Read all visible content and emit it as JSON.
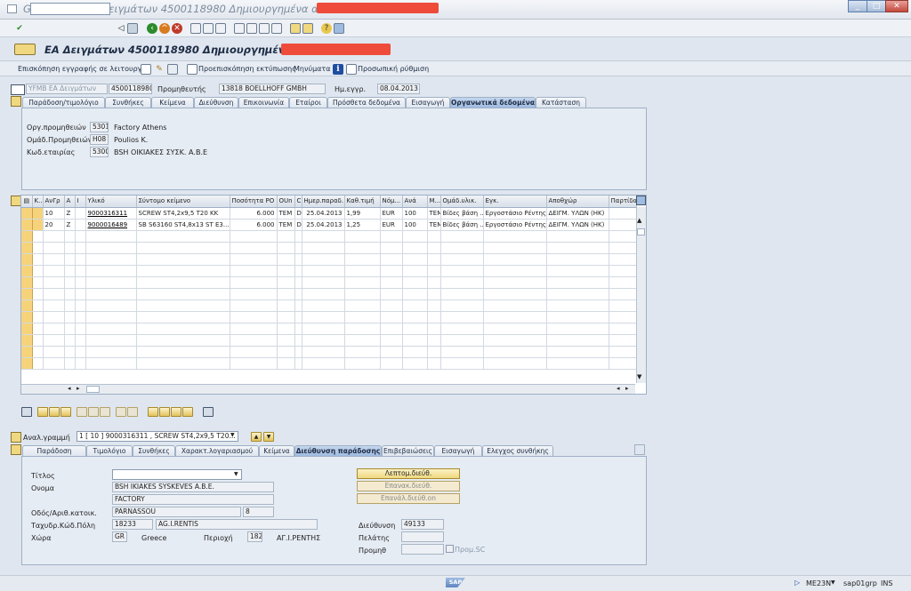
{
  "window": {
    "title": "GRP(1)/400 ΕΑ Δειγμάτων 4500118980 Δημιουργημένα από",
    "controls": [
      "_",
      "□",
      "✕"
    ]
  },
  "app": {
    "title": "ΕΑ Δειγμάτων 4500118980 Δημιουργημένα από",
    "app_toolbar": {
      "doc_overview": "Επισκόπηση εγγραφής σε λειτουργία",
      "print_preview": "Προεπισκόπηση εκτύπωσης",
      "messages": "Μηνύματα",
      "personal_settings": "Προσωπική ρύθμιση"
    }
  },
  "header": {
    "doc_type": "YFMB ΕΑ Δειγμάτων",
    "doc_number": "4500118980",
    "vendor_label": "Προμηθευτής",
    "vendor_value": "13818 BOELLHOFF GMBH",
    "date_label": "Ημ.εγγρ.",
    "date_value": "08.04.2013",
    "tabs": [
      "Παράδοση/τιμολόγιο",
      "Συνθήκες",
      "Κείμενα",
      "Διεύθυνση",
      "Επικοινωνία",
      "Εταίροι",
      "Πρόσθετα δεδομένα",
      "Εισαγωγή",
      "Οργανωτικά δεδομένα",
      "Κατάσταση"
    ],
    "org": {
      "purch_org_label": "Οργ.προμηθειών",
      "purch_org_code": "5301",
      "purch_org_name": "Factory Athens",
      "purch_group_label": "Ομάδ.Προμηθειών",
      "purch_group_code": "H08",
      "purch_group_name": "Poulios K.",
      "company_label": "Κωδ.εταιρίας",
      "company_code": "5300",
      "company_name": "BSH ΟΙΚΙΑΚΕΣ ΣΥΣΚ. Α.Β.Ε"
    }
  },
  "items": {
    "columns": [
      "Κ..",
      "ΑνΓρ",
      "Α",
      "Ι",
      "Υλικό",
      "Σύντομο κείμενο",
      "Ποσότητα PO",
      "OUn",
      "C",
      "Ημερ.παραδ.",
      "Καθ.τιμή",
      "Νόμ...",
      "Ανά",
      "Μ...",
      "Ομάδ.υλικ.",
      "Εγκ.",
      "Αποθχώρ",
      "Παρτίδα"
    ],
    "rows": [
      [
        "10",
        "Z",
        "9000316311",
        "SCREW ST4,2x9,5 T20 KK",
        "6.000",
        "TEM",
        "D",
        "25.04.2013",
        "1,99",
        "EUR",
        "100",
        "TEM",
        "Βίδες βάση ...",
        "Εργοστάσιο Ρέντης",
        "ΔΕΙΓΜ. ΥΛΩΝ (ΗΚ)"
      ],
      [
        "20",
        "Z",
        "9000016489",
        "SB S63160 ST4,8x13 ST E3...",
        "6.000",
        "TEM",
        "D",
        "25.04.2013",
        "1,25",
        "EUR",
        "100",
        "TEM",
        "Βίδες βάση ...",
        "Εργοστάσιο Ρέντης",
        "ΔΕΙΓΜ. ΥΛΩΝ (ΗΚ)"
      ]
    ]
  },
  "item_detail": {
    "label": "Αναλ.γραμμή",
    "selected": "1 [ 10 ] 9000316311 , SCREW ST4,2x9,5 T20...",
    "tabs": [
      "Παράδοση",
      "Τιμολόγιο",
      "Συνθήκες",
      "Χαρακτ.λογαριασμού",
      "Κείμενα",
      "Διεύθυνση παράδοσης",
      "Επιβεβαιώσεις",
      "Εισαγωγή",
      "Ελεγχος συνθήκης"
    ],
    "address": {
      "title_label": "Τίτλος",
      "title_value": "",
      "name_label": "Ονομα",
      "name1": "BSH IKIAKES SYSKEVES A.B.E.",
      "name2": "FACTORY",
      "street_label": "Οδός/Αριθ.κατοικ.",
      "street": "PARNASSOU",
      "house_no": "8",
      "postal_label": "Ταχυδρ.Κώδ.Πόλη",
      "postal_code": "18233",
      "city": "AG.I.RENTIS",
      "country_label": "Χώρα",
      "country_code": "GR",
      "country_name": "Greece",
      "region_label": "Περιοχή",
      "region_code": "182",
      "region_name": "ΑΓ.Ι.ΡΕΝΤΗΣ"
    },
    "buttons": {
      "detail": "Λεπτομ.διεύθ.",
      "reset": "Επανακ.διεύθ.",
      "restore": "Επανάλ.διεύθ.on"
    },
    "address_number_label": "Διεύθυνση",
    "address_number": "49133",
    "customer_label": "Πελάτης",
    "customer": "",
    "vendor_label": "Προμηθ",
    "vendor": "",
    "vendor_check": "Προμ.SC"
  },
  "status": {
    "transaction": "ME23N",
    "server": "sap01grp",
    "mode": "INS",
    "logo": "SAP"
  },
  "colors": {
    "accent": "#f6d37a",
    "red_redaction": "#ee4b3b",
    "active_tab": "#9fbbe0"
  }
}
